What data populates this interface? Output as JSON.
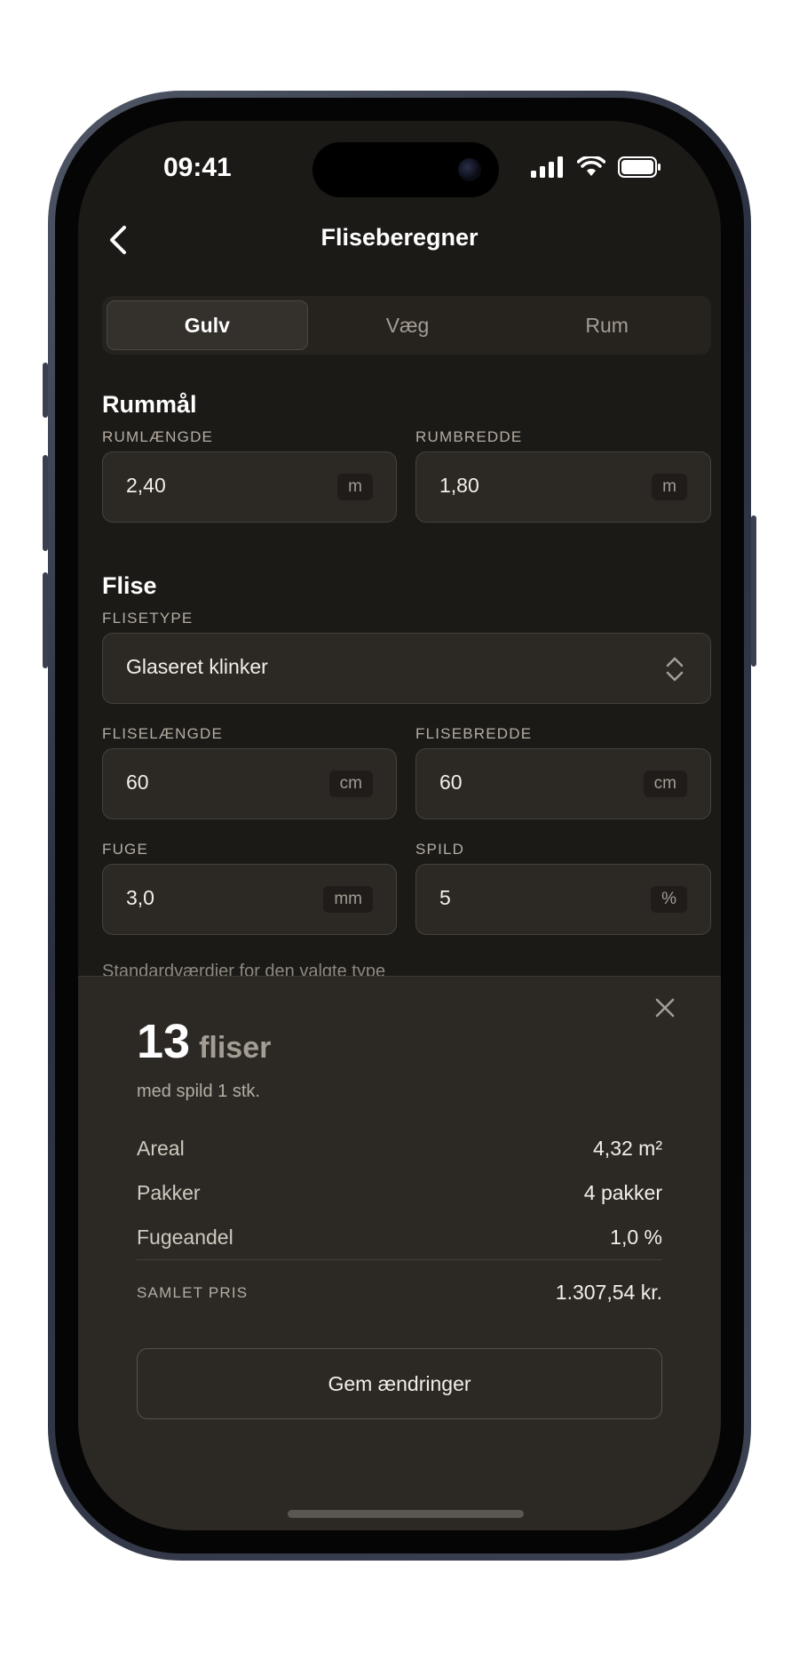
{
  "status_bar": {
    "time": "09:41"
  },
  "header": {
    "title": "Fliseberegner"
  },
  "tabs": [
    {
      "label": "Gulv",
      "active": true
    },
    {
      "label": "Væg",
      "active": false
    },
    {
      "label": "Rum",
      "active": false
    }
  ],
  "room": {
    "section_title": "Rummål",
    "length": {
      "label": "RUMLÆNGDE",
      "value": "2,40",
      "unit": "m"
    },
    "width": {
      "label": "RUMBREDDE",
      "value": "1,80",
      "unit": "m"
    }
  },
  "tile": {
    "section_title": "Flise",
    "type": {
      "label": "FLISETYPE",
      "value": "Glaseret klinker"
    },
    "length": {
      "label": "FLISELÆNGDE",
      "value": "60",
      "unit": "cm"
    },
    "width": {
      "label": "FLISEBREDDE",
      "value": "60",
      "unit": "cm"
    },
    "joint": {
      "label": "FUGE",
      "value": "3,0",
      "unit": "mm"
    },
    "waste": {
      "label": "SPILD",
      "value": "5",
      "unit": "%"
    },
    "hint": "Standardværdier for den valgte type"
  },
  "result": {
    "count": "13",
    "count_unit": "fliser",
    "subtitle": "med spild 1 stk.",
    "rows": [
      {
        "key": "Areal",
        "value": "4,32 m²"
      },
      {
        "key": "Pakker",
        "value": "4 pakker"
      },
      {
        "key": "Fugeandel",
        "value": "1,0 %"
      }
    ],
    "total_label": "SAMLET PRIS",
    "total_value": "1.307,54 kr.",
    "save_label": "Gem ændringer"
  },
  "colors": {
    "background": "#1c1a17",
    "sheet": "#2c2924",
    "field": "#2c2925"
  }
}
